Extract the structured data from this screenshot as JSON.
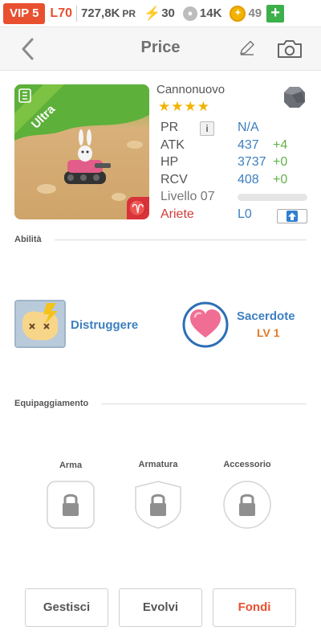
{
  "status": {
    "vip": "VIP 5",
    "level": "L70",
    "pr_value": "727,8K",
    "pr_unit": "PR",
    "energy": "30",
    "paws": "14K",
    "gold": "49",
    "add": "+"
  },
  "header": {
    "title": "Price"
  },
  "hero": {
    "name": "Cannonuovo",
    "stars": "★★★★",
    "rarity": "Ultra",
    "stats": {
      "pr_label": "PR",
      "pr_info": "i",
      "pr_value": "N/A",
      "atk_label": "ATK",
      "atk_value": "437",
      "atk_bonus": "+4",
      "hp_label": "HP",
      "hp_value": "3737",
      "hp_bonus": "+0",
      "rcv_label": "RCV",
      "rcv_value": "408",
      "rcv_bonus": "+0",
      "level_label": "Livello 07",
      "xp_progress": 0,
      "sign_label": "Ariete",
      "sign_level": "L0"
    }
  },
  "abilities": {
    "label": "Abilità",
    "ability1": {
      "name": "Distruggere"
    },
    "ability2": {
      "name": "Sacerdote",
      "level": "LV 1"
    }
  },
  "equipment": {
    "label": "Equipaggiamento",
    "weapon": "Arma",
    "armor": "Armatura",
    "accessory": "Accessorio"
  },
  "actions": {
    "manage": "Gestisci",
    "evolve": "Evolvi",
    "merge": "Fondi"
  },
  "colors": {
    "accent_orange": "#e8502f",
    "stat_blue": "#3d7fc1",
    "bonus_green": "#62b14a",
    "merge_orange": "#e8502f"
  }
}
